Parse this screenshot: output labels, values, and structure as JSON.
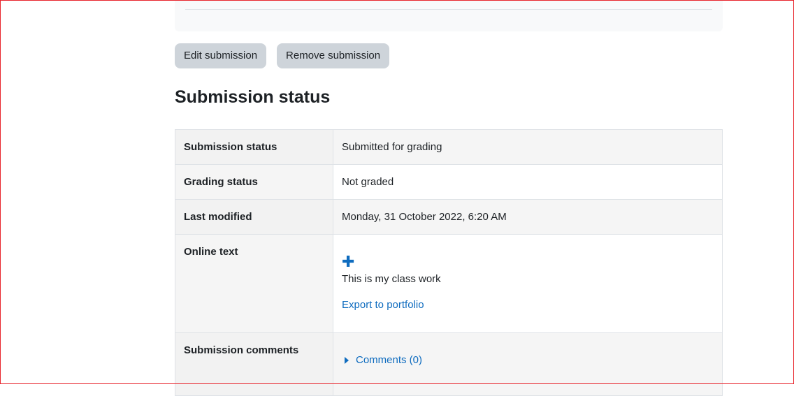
{
  "actions": {
    "edit_label": "Edit submission",
    "remove_label": "Remove submission"
  },
  "section": {
    "title": "Submission status"
  },
  "table": {
    "rows": [
      {
        "label": "Submission status",
        "value": "Submitted for grading"
      },
      {
        "label": "Grading status",
        "value": "Not graded"
      },
      {
        "label": "Last modified",
        "value": "Monday, 31 October 2022, 6:20 AM"
      },
      {
        "label": "Online text",
        "value": "This is my class work",
        "link": "Export to portfolio",
        "icon": "plus-icon"
      },
      {
        "label": "Submission comments",
        "link": "Comments (0)",
        "icon": "caret-right-icon"
      }
    ]
  },
  "colors": {
    "accent": "#0f6cbf",
    "submitted_bg": "#cfefd0",
    "button_bg": "#ced4da",
    "frame_border": "#e8242c"
  }
}
